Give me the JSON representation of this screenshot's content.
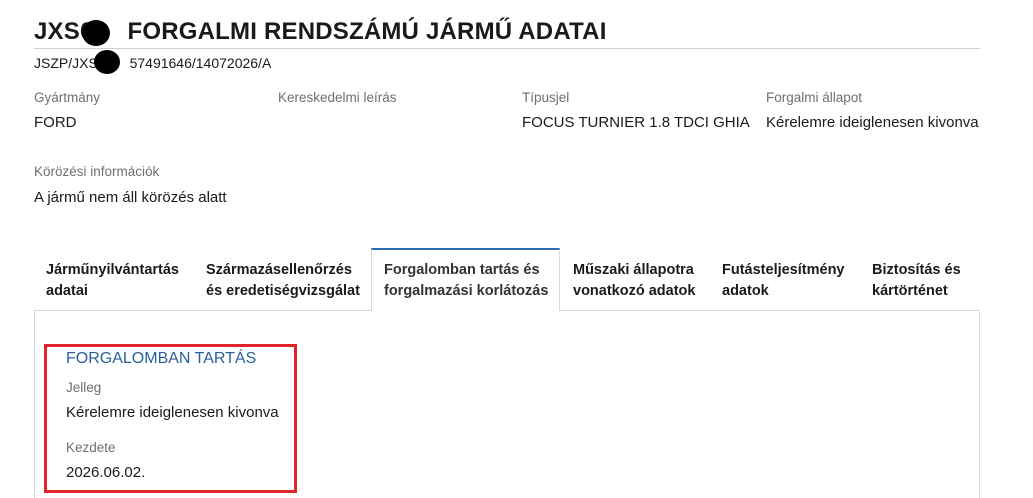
{
  "header": {
    "title_prefix": "JXS6",
    "title_suffix": "FORGALMI RENDSZÁMÚ JÁRMŰ ADATAI",
    "subtitle_prefix": "JSZP/JXS6",
    "subtitle_suffix": "57491646/14072026/A"
  },
  "fields": {
    "manufacturer": {
      "label": "Gyártmány",
      "value": "FORD"
    },
    "commercial_description": {
      "label": "Kereskedelmi leírás",
      "value": ""
    },
    "type_code": {
      "label": "Típusjel",
      "value": "FOCUS TURNIER 1.8 TDCI GHIA"
    },
    "traffic_status": {
      "label": "Forgalmi állapot",
      "value": "Kérelemre ideiglenesen kivonva"
    },
    "wanted_info": {
      "label": "Körözési információk",
      "value": "A jármű nem áll körözés alatt"
    }
  },
  "tabs": [
    {
      "line1": "Járműnyilvántartás",
      "line2": "adatai"
    },
    {
      "line1": "Származásellenőrzés",
      "line2": "és eredetiségvizsgálat"
    },
    {
      "line1": "Forgalomban tartás és",
      "line2": "forgalmazási korlátozás"
    },
    {
      "line1": "Műszaki állapotra",
      "line2": "vonatkozó adatok"
    },
    {
      "line1": "Futásteljesítmény",
      "line2": "adatok"
    },
    {
      "line1": "Biztosítás és",
      "line2": "kártörténet"
    }
  ],
  "active_tab_index": 2,
  "panel": {
    "section_title": "FORGALOMBAN TARTÁS",
    "nature": {
      "label": "Jelleg",
      "value": "Kérelemre ideiglenesen kivonva"
    },
    "start": {
      "label": "Kezdete",
      "value": "2026.06.02."
    }
  },
  "colors": {
    "accent_blue": "#2a5e99",
    "active_tab_border": "#2f6fb1",
    "highlight_red": "#e0242b"
  }
}
